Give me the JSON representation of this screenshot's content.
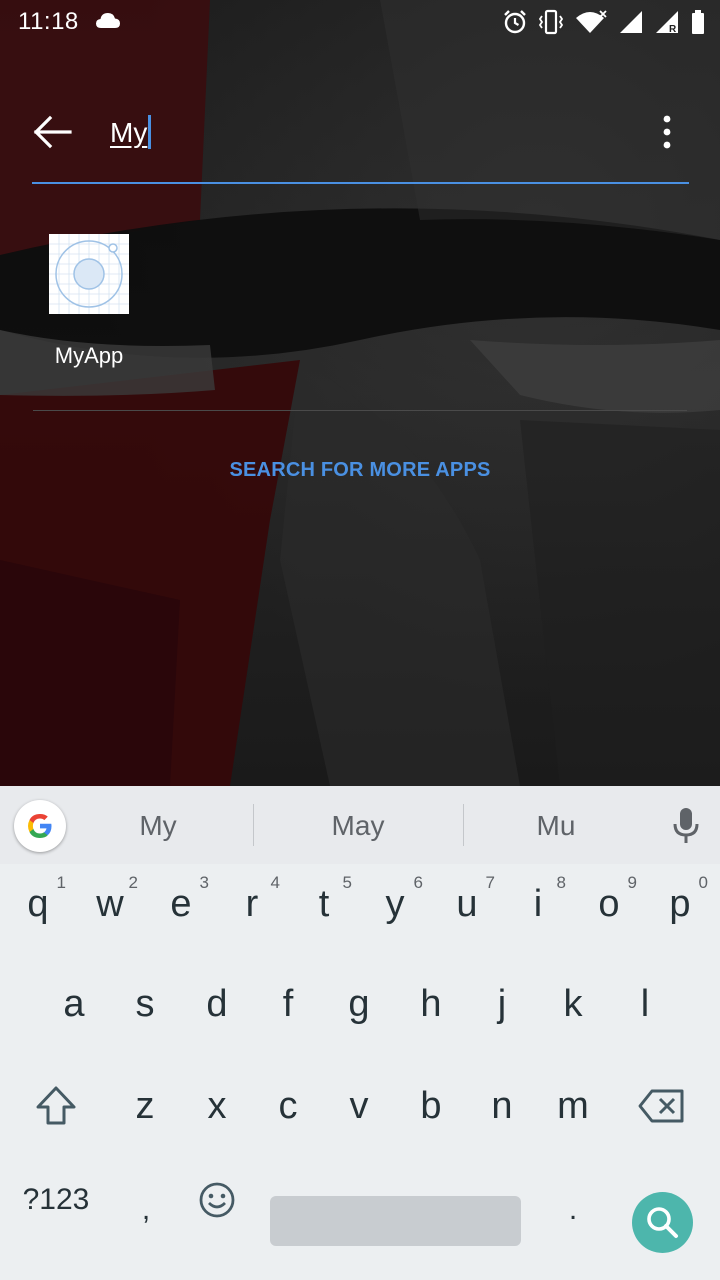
{
  "status_bar": {
    "time": "11:18",
    "left_icons": [
      "cloud-icon"
    ],
    "right_icons": [
      "alarm-icon",
      "vibrate-icon",
      "wifi-icon",
      "signal-icon",
      "roaming-signal-icon",
      "battery-icon"
    ]
  },
  "search": {
    "query": "My",
    "accent_color": "#4a90e2"
  },
  "results": {
    "apps": [
      {
        "label": "MyApp",
        "icon": "myapp-icon"
      }
    ],
    "more_label": "SEARCH FOR MORE APPS"
  },
  "keyboard": {
    "suggestions": [
      "My",
      "May",
      "Mu"
    ],
    "row1": [
      {
        "key": "q",
        "hint": "1"
      },
      {
        "key": "w",
        "hint": "2"
      },
      {
        "key": "e",
        "hint": "3"
      },
      {
        "key": "r",
        "hint": "4"
      },
      {
        "key": "t",
        "hint": "5"
      },
      {
        "key": "y",
        "hint": "6"
      },
      {
        "key": "u",
        "hint": "7"
      },
      {
        "key": "i",
        "hint": "8"
      },
      {
        "key": "o",
        "hint": "9"
      },
      {
        "key": "p",
        "hint": "0"
      }
    ],
    "row2": [
      "a",
      "s",
      "d",
      "f",
      "g",
      "h",
      "j",
      "k",
      "l"
    ],
    "row3": [
      "z",
      "x",
      "c",
      "v",
      "b",
      "n",
      "m"
    ],
    "symbols_label": "?123",
    "comma": ",",
    "period": ".",
    "action_color": "#4db6ac"
  }
}
